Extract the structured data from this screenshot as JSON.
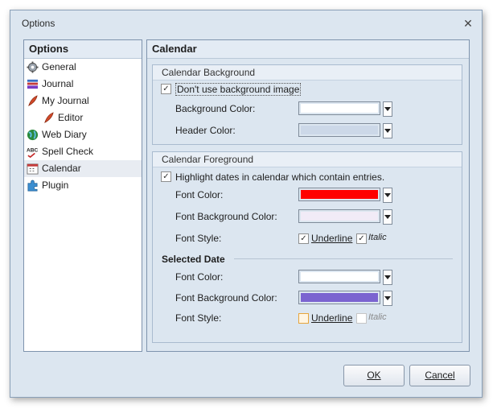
{
  "window": {
    "title": "Options"
  },
  "nav": {
    "header": "Options",
    "items": [
      {
        "label": "General",
        "icon": "gear-icon"
      },
      {
        "label": "Journal",
        "icon": "books-icon"
      },
      {
        "label": "My Journal",
        "icon": "feather-icon"
      },
      {
        "label": "Editor",
        "icon": "feather-icon"
      },
      {
        "label": "Web Diary",
        "icon": "globe-icon"
      },
      {
        "label": "Spell Check",
        "icon": "abc-icon"
      },
      {
        "label": "Calendar",
        "icon": "calendar-icon"
      },
      {
        "label": "Plugin",
        "icon": "puzzle-icon"
      }
    ],
    "selected": "Calendar"
  },
  "page": {
    "title": "Calendar"
  },
  "background": {
    "title": "Calendar Background",
    "no_bg_image": {
      "label": "Don't use background image",
      "checked": true
    },
    "bg_color": {
      "label": "Background Color:",
      "color": "#ffffff"
    },
    "header_color": {
      "label": "Header Color:",
      "color": "#ccd8e8"
    }
  },
  "foreground": {
    "title": "Calendar Foreground",
    "highlight": {
      "label": "Highlight dates in calendar which contain entries.",
      "checked": true
    },
    "font_color": {
      "label": "Font Color:",
      "color": "#ff0000"
    },
    "font_bg_color": {
      "label": "Font Background Color:",
      "color": "#f1ebf7"
    },
    "font_style": {
      "label": "Font Style:",
      "underline": "Underline",
      "underline_checked": true,
      "italic": "Italic",
      "italic_checked": true
    }
  },
  "selected_date": {
    "title": "Selected Date",
    "font_color": {
      "label": "Font Color:",
      "color": "#ffffff"
    },
    "font_bg_color": {
      "label": "Font Background Color:",
      "color": "#7b64d0"
    },
    "font_style": {
      "label": "Font Style:",
      "underline": "Underline",
      "underline_checked": false,
      "italic": "Italic",
      "italic_checked": false
    }
  },
  "buttons": {
    "ok": "OK",
    "cancel": "Cancel"
  }
}
